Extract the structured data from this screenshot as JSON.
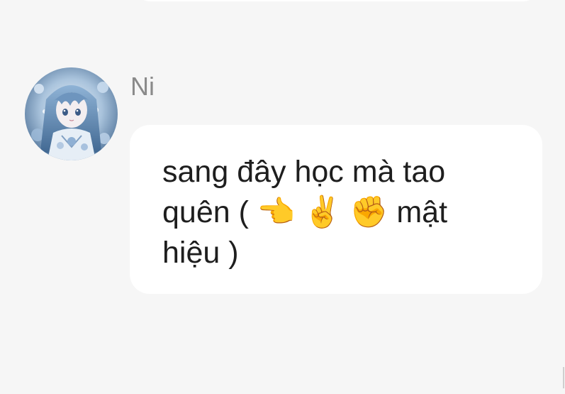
{
  "message": {
    "sender_name": "Ni",
    "text": "sang đây học mà tao quên ( 👈 ✌️ ✊  mật hiệu )"
  },
  "avatar": {
    "icon": "anime-girl-avatar",
    "colors": {
      "primary": "#7fa3c8",
      "secondary": "#dfe9f3",
      "accent": "#3a5f8a"
    }
  },
  "theme": {
    "background": "#f6f6f6",
    "bubble": "#ffffff",
    "name_color": "#8a8a8a",
    "text_color": "#1e1e1e"
  }
}
